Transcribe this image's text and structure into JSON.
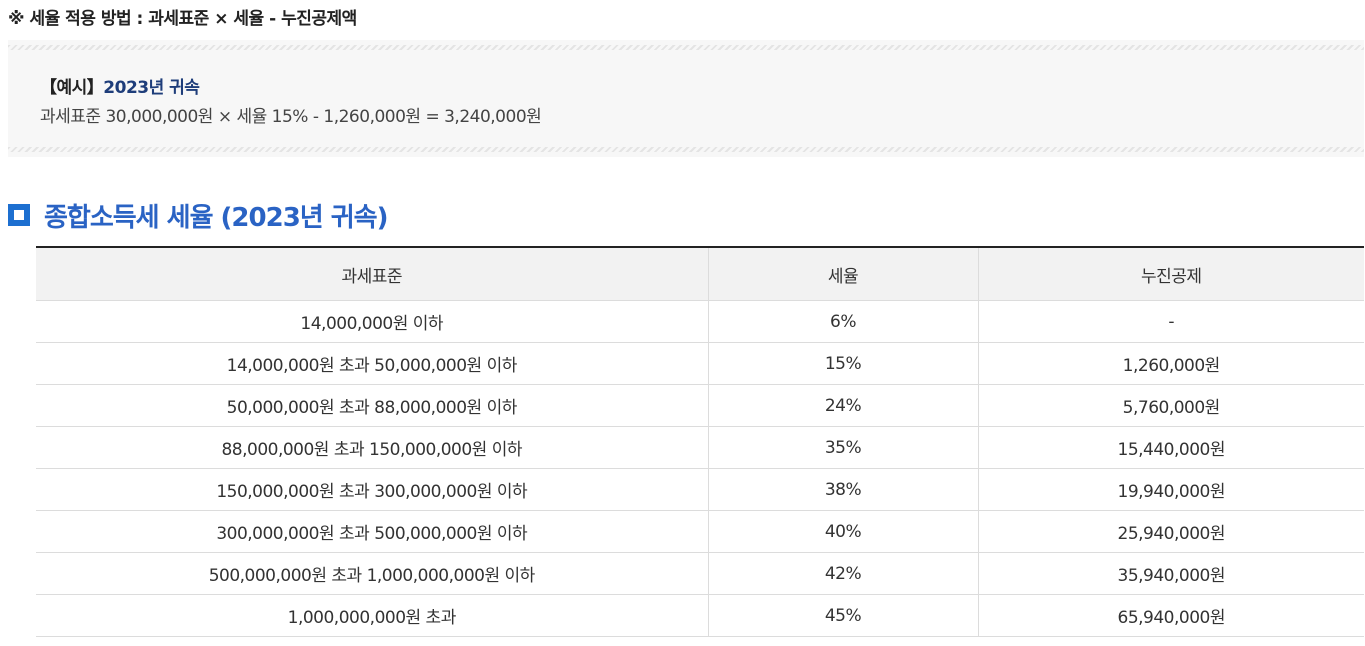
{
  "rule": {
    "title": "※ 세율 적용 방법 : 과세표준 × 세율 - 누진공제액"
  },
  "example": {
    "label": "【예시】",
    "year_text": "2023년 귀속",
    "formula": "과세표준 30,000,000원 × 세율 15% - 1,260,000원 = 3,240,000원"
  },
  "section": {
    "title": "종합소득세 세율 (2023년 귀속)"
  },
  "table": {
    "headers": [
      "과세표준",
      "세율",
      "누진공제"
    ],
    "rows": [
      [
        "14,000,000원 이하",
        "6%",
        "-"
      ],
      [
        "14,000,000원 초과 50,000,000원 이하",
        "15%",
        "1,260,000원"
      ],
      [
        "50,000,000원 초과 88,000,000원 이하",
        "24%",
        "5,760,000원"
      ],
      [
        "88,000,000원 초과 150,000,000원 이하",
        "35%",
        "15,440,000원"
      ],
      [
        "150,000,000원 초과 300,000,000원 이하",
        "38%",
        "19,940,000원"
      ],
      [
        "300,000,000원 초과 500,000,000원 이하",
        "40%",
        "25,940,000원"
      ],
      [
        "500,000,000원 초과 1,000,000,000원 이하",
        "42%",
        "35,940,000원"
      ],
      [
        "1,000,000,000원 초과",
        "45%",
        "65,940,000원"
      ]
    ]
  },
  "colors": {
    "accent": "#2a63c4",
    "icon": "#1d6fd0",
    "example_year": "#1e3d7a"
  }
}
